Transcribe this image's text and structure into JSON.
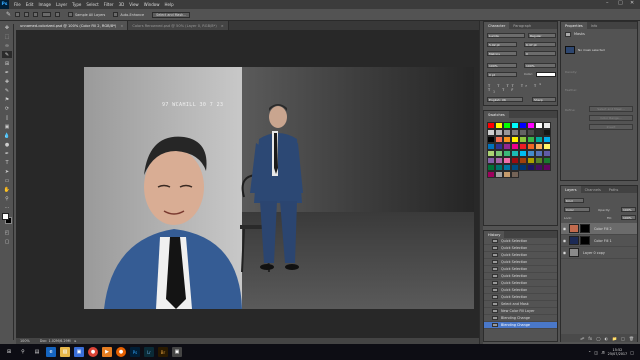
{
  "app": {
    "logo": "Ps"
  },
  "menu": [
    "File",
    "Edit",
    "Image",
    "Layer",
    "Type",
    "Select",
    "Filter",
    "3D",
    "View",
    "Window",
    "Help"
  ],
  "window_controls": [
    "–",
    "□",
    "✕"
  ],
  "options": {
    "sample_all_label": "Sample All Layers",
    "auto_enhance_label": "Auto-Enhance",
    "select_mask_label": "Select and Mask..."
  },
  "tabs": [
    {
      "label": "unnamed-colorized.psd @ 100% (Color Fill 2, RGB/8*)",
      "close": "×"
    },
    {
      "label": "Colors Rerowned.psd @ 50% (Layer 0, RGB/8*)",
      "close": "×"
    }
  ],
  "photo": {
    "caption": "97 WCAHILL 30 7 23"
  },
  "status": {
    "zoom": "100%",
    "doc": "Doc: 1.02M/6.29M",
    "arrow": "▸"
  },
  "character": {
    "tabs": [
      "Character",
      "Paragraph"
    ],
    "font": "Lucida",
    "style": "Regular",
    "size": "5.92 pt",
    "leading": "6.47 pt",
    "kerning": "Metrics",
    "tracking": "0",
    "scale_v": "100%",
    "scale_h": "100%",
    "baseline": "0 pt",
    "color_label": "Color:",
    "language": "English: UK",
    "aa": "Sharp"
  },
  "properties": {
    "tabs": [
      "Properties",
      "Info"
    ],
    "title": "Masks",
    "mask_text": "No mask selected",
    "density": "Density:",
    "feather": "Feather:",
    "refine": "Refine:",
    "btn1": "Select and Mask...",
    "btn2": "Color Range...",
    "btn3": "Invert"
  },
  "swatches": {
    "tabs": [
      "Swatches"
    ],
    "colors": [
      "#ff0000",
      "#ffff00",
      "#00ff00",
      "#00ffff",
      "#0000ff",
      "#ff00ff",
      "#ffffff",
      "#ececec",
      "#cfcfcf",
      "#b5b5b5",
      "#989898",
      "#7d7d7d",
      "#636363",
      "#4a4a4a",
      "#2e2e2e",
      "#161616",
      "#000000",
      "#f26c4f",
      "#f7941d",
      "#fff200",
      "#8dc73f",
      "#39b54a",
      "#00a99d",
      "#00aeef",
      "#0072bc",
      "#2e3192",
      "#92278f",
      "#ec008c",
      "#ed1c24",
      "#f26522",
      "#fbaf5d",
      "#fff568",
      "#acd373",
      "#7cc576",
      "#3cb878",
      "#1cbbb4",
      "#00bff3",
      "#448ccb",
      "#5674b9",
      "#605ca8",
      "#8560a8",
      "#a864a8",
      "#f06eaa",
      "#9e0b0f",
      "#a0410d",
      "#aba000",
      "#598527",
      "#197b30",
      "#007236",
      "#00746b",
      "#0076a3",
      "#004a80",
      "#003471",
      "#1b1464",
      "#440e62",
      "#630460",
      "#9e005d",
      "#a0a0a0",
      "#c69c6d",
      "#736357"
    ]
  },
  "history": {
    "tabs": [
      "History"
    ],
    "items": [
      "Quick Selection",
      "Quick Selection",
      "Quick Selection",
      "Quick Selection",
      "Quick Selection",
      "Quick Selection",
      "Quick Selection",
      "Quick Selection",
      "Quick Selection",
      "Select and Mask",
      "New Color Fill Layer",
      "Blending Change",
      "Blending Change"
    ]
  },
  "layers": {
    "tabs": [
      "Layers",
      "Channels",
      "Paths"
    ],
    "kind": "Kind",
    "blend": "Color",
    "opacity_label": "Opacity:",
    "opacity": "100%",
    "lock_label": "Lock:",
    "fill_label": "Fill:",
    "fill": "100%",
    "items": [
      {
        "name": "Color Fill 2",
        "thumb": "#c26b4e"
      },
      {
        "name": "Color Fill 1",
        "thumb": "#1c2a55"
      },
      {
        "name": "Layer 0 copy",
        "thumb": "#8a8a8a"
      }
    ]
  },
  "taskbar": {
    "time": "15:52",
    "date": "25/07/2017"
  }
}
